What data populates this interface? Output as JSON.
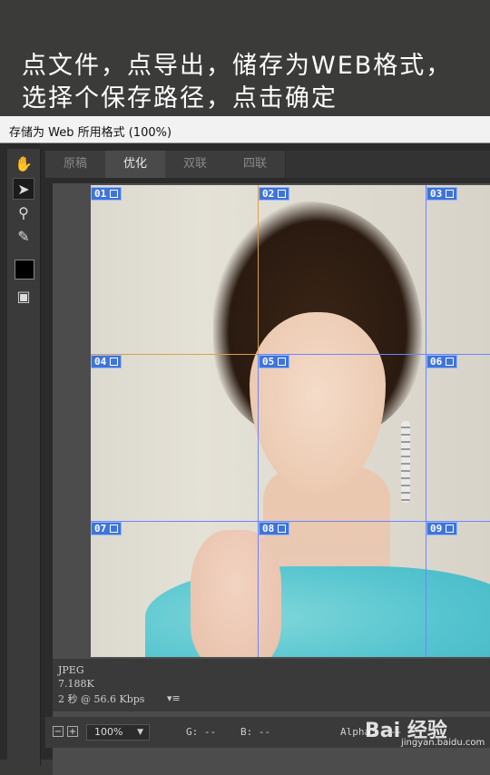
{
  "caption": {
    "line1": "点文件，点导出，储存为WEB格式，",
    "line2": "选择个保存路径，点击确定"
  },
  "dialog": {
    "title": "存储为 Web 所用格式 (100%)"
  },
  "tabs": [
    {
      "label": "原稿"
    },
    {
      "label": "优化"
    },
    {
      "label": "双联"
    },
    {
      "label": "四联"
    }
  ],
  "slices": [
    "01",
    "02",
    "03",
    "04",
    "05",
    "06",
    "07",
    "08",
    "09"
  ],
  "status": {
    "format": "JPEG",
    "size": "7.188K",
    "time": "2 秒 @ 56.6 Kbps",
    "menu_icon": "▾≡"
  },
  "bottom": {
    "zoom_out": "−",
    "zoom_in": "+",
    "zoom": "100%",
    "g": "G: --",
    "b": "B: --",
    "alpha": "Alpha:",
    "extra": "--"
  },
  "watermark": {
    "brand": "Bai 经验",
    "url": "jingyan.baidu.com"
  },
  "colors": {
    "slice_blue": "#3f74d8",
    "active_slice": "#d8a24a"
  }
}
